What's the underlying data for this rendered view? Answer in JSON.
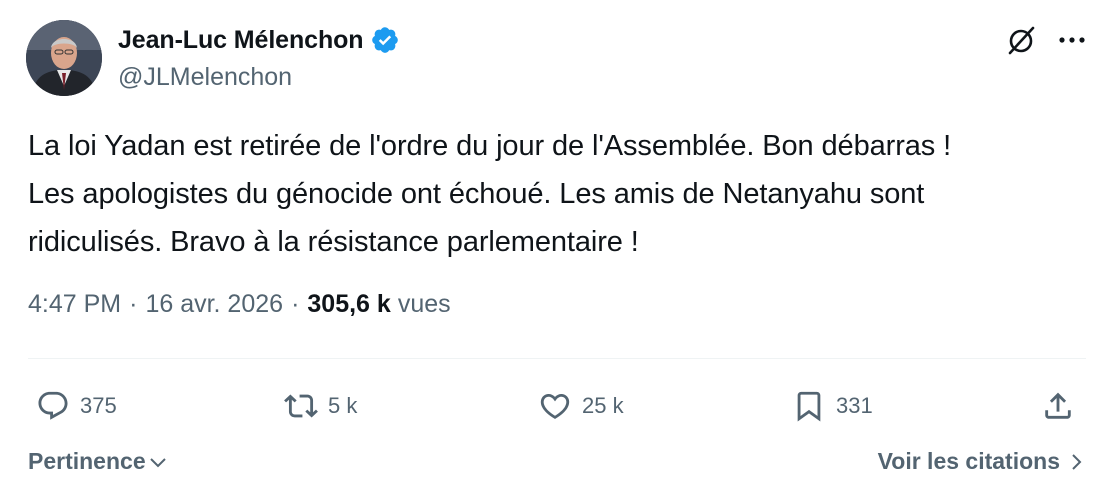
{
  "author": {
    "display_name": "Jean-Luc Mélenchon",
    "handle": "@JLMelenchon",
    "verified": true,
    "verified_color": "#1d9bf0"
  },
  "tweet": {
    "text": "La loi Yadan est retirée de l'ordre du jour de l'Assemblée. Bon débarras !\nLes apologistes du génocide ont échoué. Les amis de Netanyahu sont\nridiculisés. Bravo à la résistance parlementaire !",
    "time": "4:47 PM",
    "separator": "·",
    "date": "16 avr. 2026",
    "views_count": "305,6 k",
    "views_label": "vues"
  },
  "header_icons": {
    "grok": "grok-icon",
    "more": "more-options-icon"
  },
  "actions": {
    "reply": {
      "icon": "reply-icon",
      "count": "375"
    },
    "retweet": {
      "icon": "retweet-icon",
      "count": "5 k"
    },
    "like": {
      "icon": "heart-icon",
      "count": "25 k"
    },
    "bookmark": {
      "icon": "bookmark-icon",
      "count": "331"
    },
    "share": {
      "icon": "share-icon"
    }
  },
  "footer": {
    "sort_label": "Pertinence",
    "quotes_link": "Voir les citations"
  },
  "colors": {
    "text_primary": "#0f1419",
    "text_secondary": "#536471",
    "divider": "#eff3f4"
  }
}
